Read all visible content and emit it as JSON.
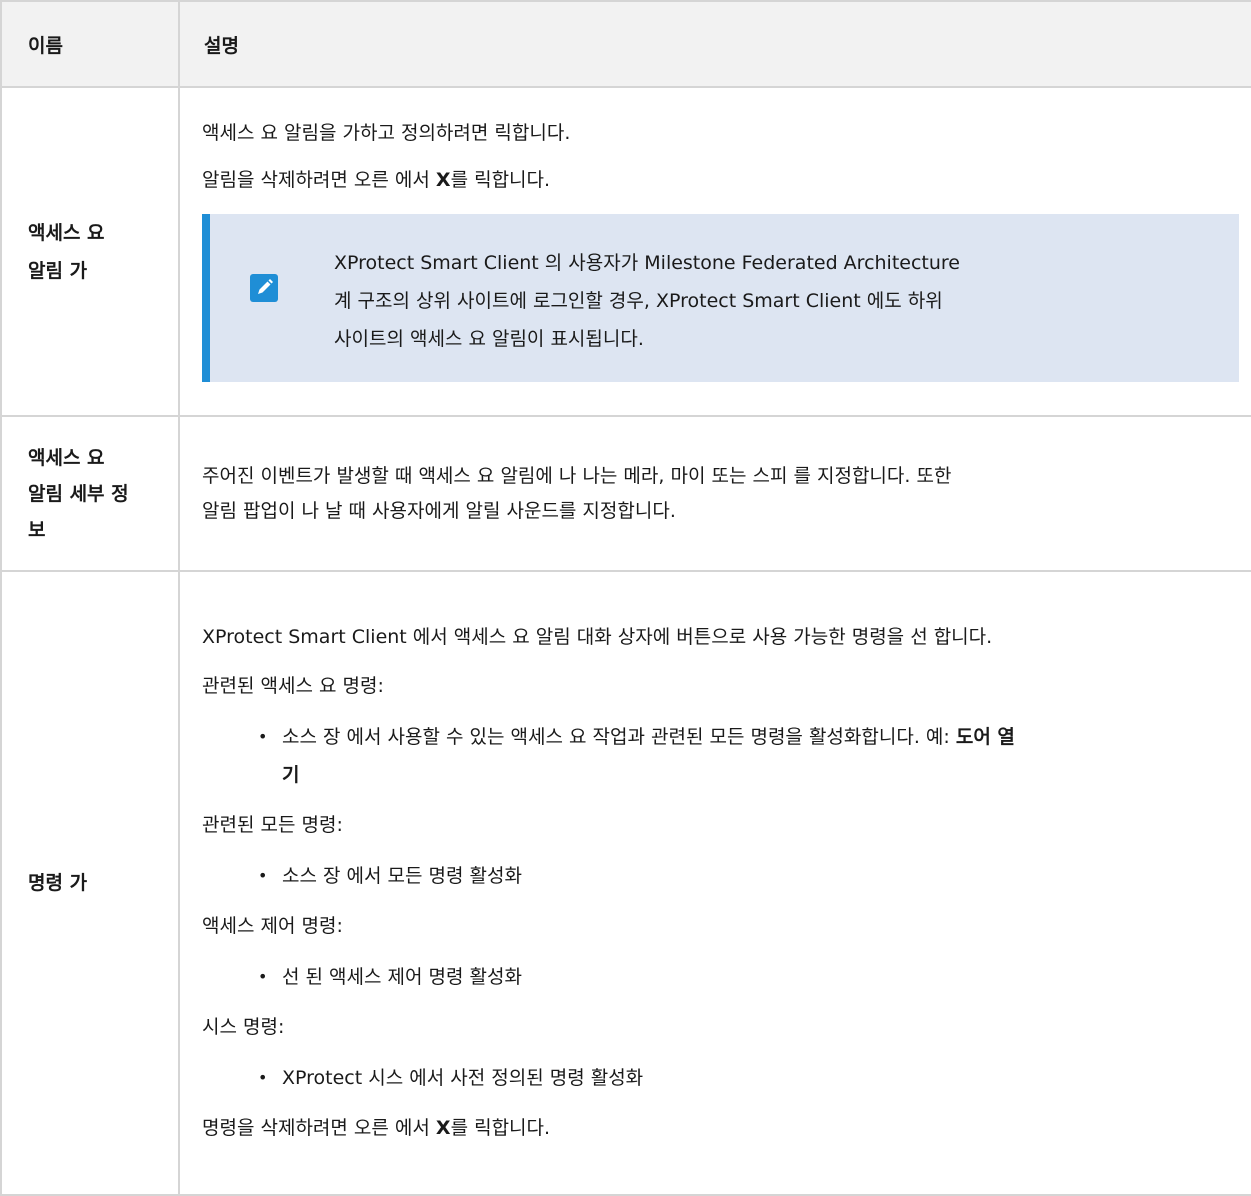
{
  "header": {
    "col_name": "이름",
    "col_desc": "설명"
  },
  "rows": [
    {
      "name_line1": "액세스 요",
      "name_line2": "알림    가",
      "desc_p1": "액세스 요    알림을    가하고 정의하려면    릭합니다.",
      "desc_p2_pre": "알림을 삭제하려면 오른    에서 ",
      "desc_p2_bold": "X",
      "desc_p2_post": "를    릭합니다.",
      "note_line1": "XProtect Smart Client 의 사용자가 Milestone Federated Architecture",
      "note_line2": "계    구조의 상위 사이트에 로그인할 경우, XProtect Smart Client 에도 하위",
      "note_line3": "사이트의 액세스 요    알림이 표시됩니다.",
      "note_icon": "pencil-note-icon"
    },
    {
      "name_line1": "액세스 요",
      "name_line2": "알림 세부 정",
      "name_line3": "보",
      "desc_line1": "주어진 이벤트가 발생할 때 액세스 요    알림에 나    나는    메라, 마이    또는 스피    를 지정합니다. 또한",
      "desc_line2": "알림 팝업이 나    날 때 사용자에게 알릴 사운드를 지정합니다."
    },
    {
      "name": "명령    가",
      "desc_p1": "XProtect Smart Client 에서 액세스 요    알림 대화 상자에 버튼으로 사용 가능한 명령을 선    합니다.",
      "label_related_access": "관련된 액세스 요    명령:",
      "bullet_related_access_pre": "소스 장    에서 사용할 수 있는 액세스 요    작업과 관련된 모든 명령을 활성화합니다. 예: ",
      "bullet_related_access_bold1": "도어 열",
      "bullet_related_access_bold2": "기",
      "label_related_all": "관련된 모든 명령:",
      "bullet_related_all": "소스 장    에서 모든 명령 활성화",
      "label_access_control": "액세스 제어 명령:",
      "bullet_access_control": "선    된 액세스 제어 명령 활성화",
      "label_system": "시스    명령:",
      "bullet_system": "XProtect 시스    에서 사전 정의된 명령 활성화",
      "delete_pre": "명령을 삭제하려면 오른    에서 ",
      "delete_bold": "X",
      "delete_post": "를    릭합니다."
    }
  ],
  "colors": {
    "header_bg": "#f2f2f2",
    "border": "#d5d5d5",
    "note_bg": "#dde5f2",
    "note_accent": "#1f8ed6"
  }
}
